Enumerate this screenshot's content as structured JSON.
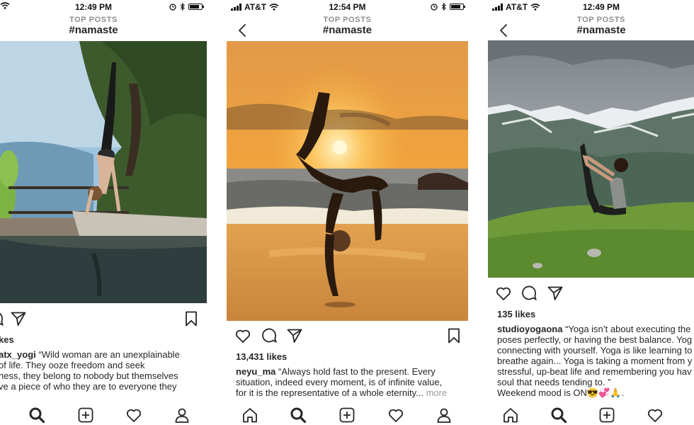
{
  "colors": {
    "text": "#262626",
    "muted": "#8e8e8e"
  },
  "phones": [
    {
      "status": {
        "time": "12:49 PM",
        "carrier": ""
      },
      "header": {
        "subtitle": "TOP POSTS",
        "title": "#namaste",
        "back_icon": ""
      },
      "post": {
        "likes": "kes",
        "caption_user": "atx_yogi",
        "caption_text": " “Wild woman are an unexplainable\nof life. They ooze freedom and seek\nness, they belong to nobody but themselves\nve a piece of who they are to everyone they"
      }
    },
    {
      "status": {
        "time": "12:54 PM",
        "carrier": "AT&T"
      },
      "header": {
        "subtitle": "TOP POSTS",
        "title": "#namaste",
        "back_icon": "chevron-left-icon"
      },
      "post": {
        "likes": "13,431 likes",
        "caption_user": "neyu_ma",
        "caption_text": " “Always hold fast to the present. Every\nsituation, indeed every moment, is of infinite value,\nfor it is the representative of a whole eternity...",
        "caption_more": " more"
      }
    },
    {
      "status": {
        "time": "12:49 PM",
        "carrier": "AT&T"
      },
      "header": {
        "subtitle": "TOP POSTS",
        "title": "#namaste",
        "back_icon": "chevron-left-icon"
      },
      "post": {
        "likes": "135 likes",
        "caption_user": "studioyogaona",
        "caption_text": " “Yoga isn’t about executing the\nposes perfectly, or having the best balance. Yog\nconnecting with yourself. Yoga is like learning to\nbreathe again... Yoga is taking a moment from y\nstressful, up-beat life and remembering you hav\nsoul that needs tending to. ”\nWeekend mood is ON😎💞🙏."
      }
    }
  ]
}
